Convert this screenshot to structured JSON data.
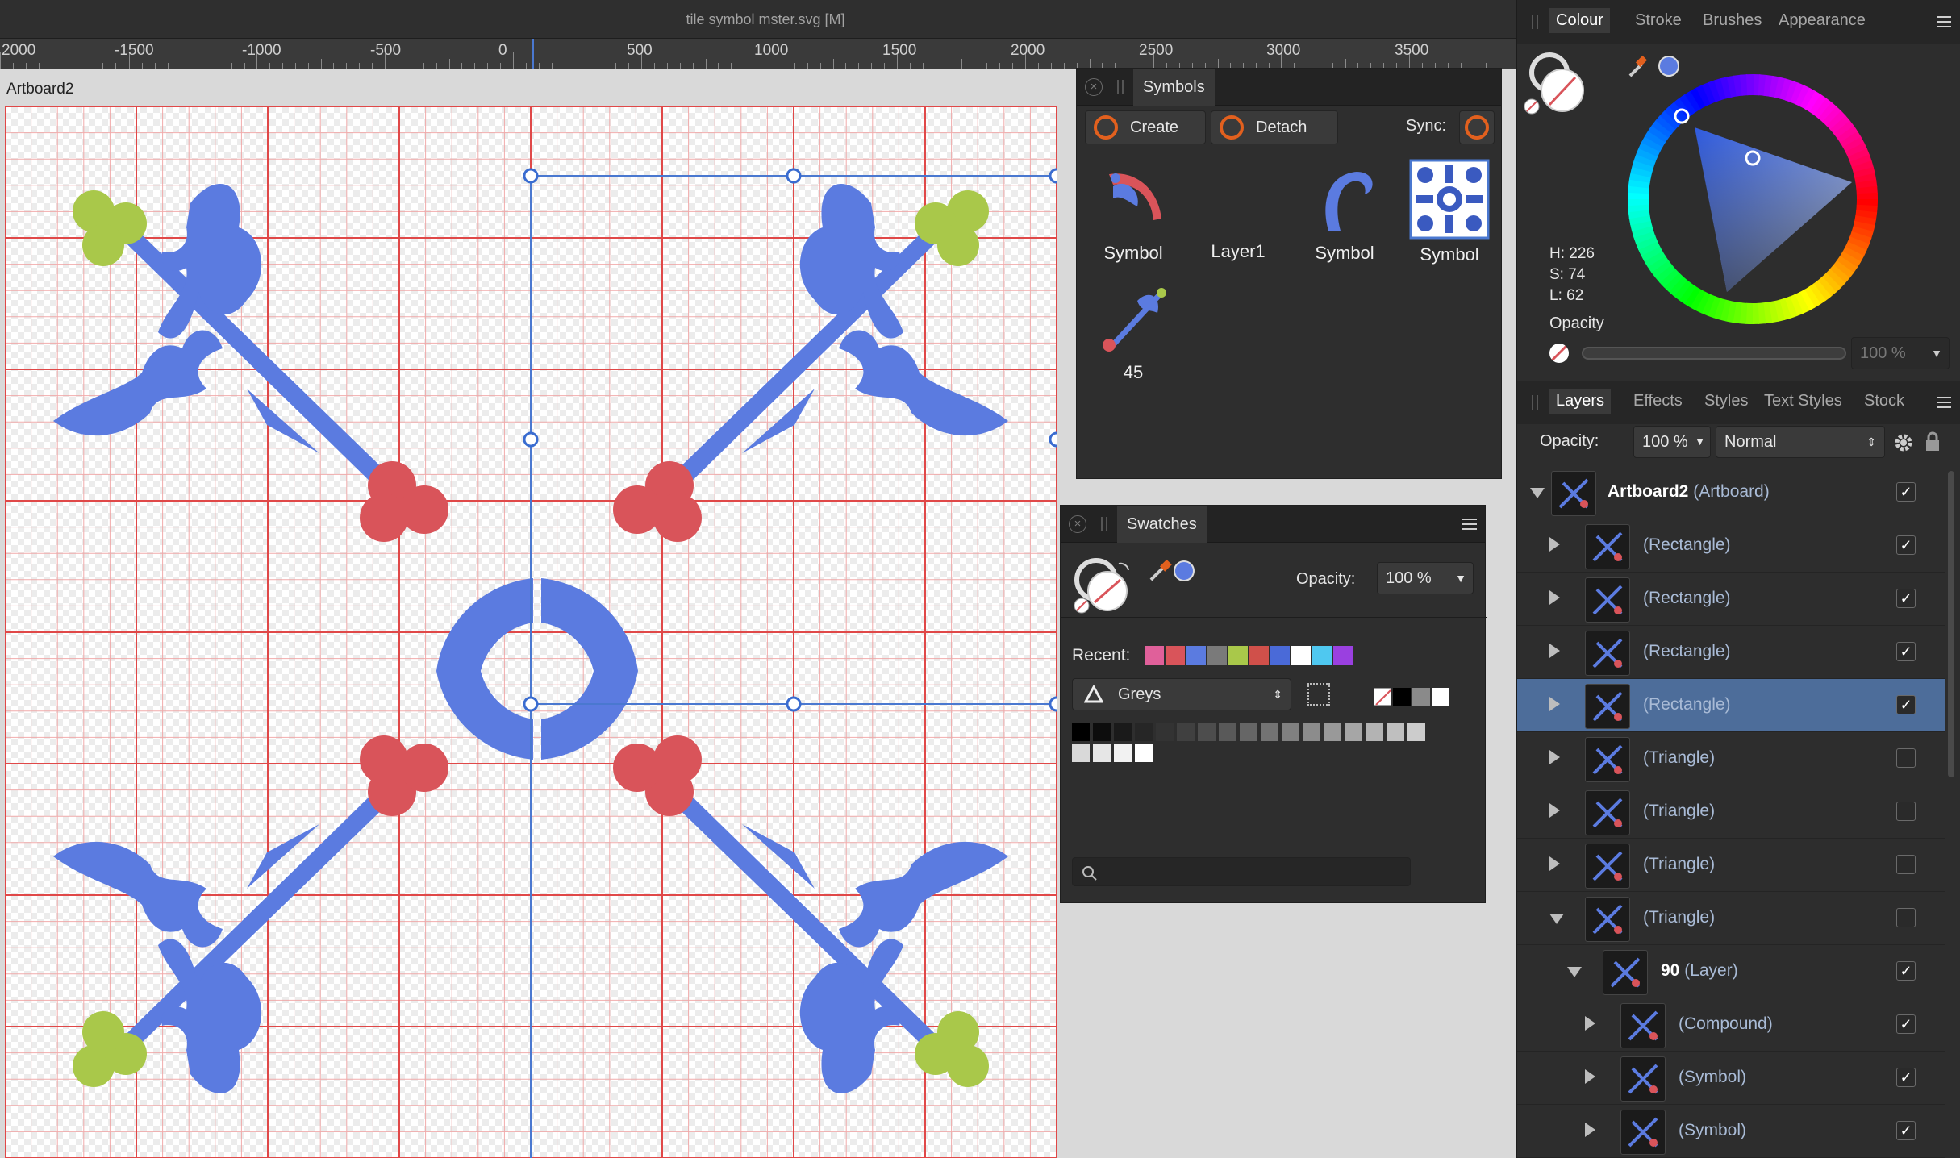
{
  "window": {
    "title": "tile symbol mster.svg [M]"
  },
  "ruler": {
    "labels": [
      "2000",
      "-1500",
      "-1000",
      "-500",
      "0",
      "500",
      "1000",
      "1500",
      "2000",
      "2500",
      "3000",
      "3500"
    ]
  },
  "canvas": {
    "artboard_label": "Artboard2"
  },
  "symbols_panel": {
    "tab": "Symbols",
    "create_label": "Create",
    "detach_label": "Detach",
    "sync_label": "Sync:",
    "items": [
      {
        "label": "Symbol",
        "icon": "red-blue-flourish-icon"
      },
      {
        "label": "Layer1",
        "icon": "empty-icon"
      },
      {
        "label": "Symbol",
        "icon": "blue-curl-icon"
      },
      {
        "label": "Symbol",
        "icon": "blue-tile-icon"
      },
      {
        "label": "45",
        "icon": "diagonal-branch-icon"
      }
    ]
  },
  "swatches_panel": {
    "tab": "Swatches",
    "opacity_label": "Opacity:",
    "opacity_value": "100 %",
    "recent_label": "Recent:",
    "recent_colors": [
      "#e0609a",
      "#d9545a",
      "#5b7be0",
      "#7a7a7a",
      "#a9c84a",
      "#d0504a",
      "#4a6ad8",
      "#ffffff",
      "#4fc8f0",
      "#9a40e0"
    ],
    "palette_name": "Greys",
    "search_placeholder": ""
  },
  "colour_panel": {
    "tabs": [
      "Colour",
      "Stroke",
      "Brushes",
      "Appearance"
    ],
    "active_tab": "Colour",
    "h": "H: 226",
    "s": "S: 74",
    "l": "L: 62",
    "opacity_label": "Opacity",
    "opacity_value": "100 %",
    "fill_color": "#5b7be0"
  },
  "layers_panel": {
    "tabs": [
      "Layers",
      "Effects",
      "Styles",
      "Text Styles",
      "Stock"
    ],
    "active_tab": "Layers",
    "opacity_label": "Opacity:",
    "opacity_value": "100 %",
    "blend_mode": "Normal",
    "rows": [
      {
        "name": "Artboard2",
        "type": "(Artboard)",
        "checked": "✓"
      },
      {
        "name": "",
        "type": "(Rectangle)",
        "checked": "✓"
      },
      {
        "name": "",
        "type": "(Rectangle)",
        "checked": "✓"
      },
      {
        "name": "",
        "type": "(Rectangle)",
        "checked": "✓"
      },
      {
        "name": "",
        "type": "(Rectangle)",
        "checked": "✓"
      },
      {
        "name": "",
        "type": "(Triangle)",
        "checked": ""
      },
      {
        "name": "",
        "type": "(Triangle)",
        "checked": ""
      },
      {
        "name": "",
        "type": "(Triangle)",
        "checked": ""
      },
      {
        "name": "",
        "type": "(Triangle)",
        "checked": ""
      },
      {
        "name": "90",
        "type": "(Layer)",
        "checked": "✓"
      },
      {
        "name": "",
        "type": "(Compound)",
        "checked": "✓"
      },
      {
        "name": "",
        "type": "(Symbol)",
        "checked": "✓"
      },
      {
        "name": "",
        "type": "(Symbol)",
        "checked": "✓"
      }
    ]
  },
  "colors": {
    "accent": "#e2601e",
    "selection": "#4d6d9a",
    "motif_blue": "#5b7be0",
    "motif_red": "#d9545a",
    "motif_green": "#a9c84a"
  }
}
